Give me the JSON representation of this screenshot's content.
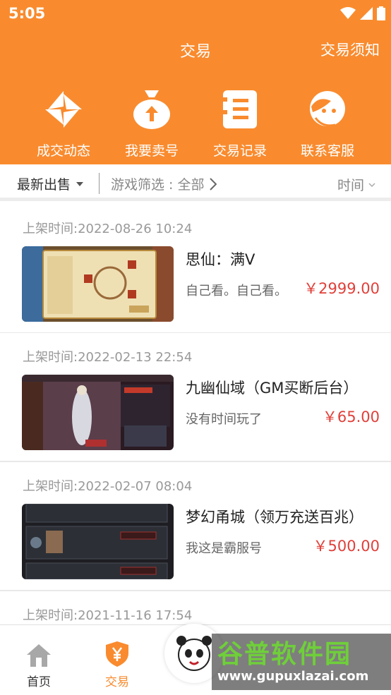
{
  "status_bar": {
    "time": "5:05"
  },
  "header": {
    "title": "交易",
    "notice": "交易须知"
  },
  "quick_menu": [
    {
      "label": "成交动态",
      "icon": "deals-icon"
    },
    {
      "label": "我要卖号",
      "icon": "money-bag-icon"
    },
    {
      "label": "交易记录",
      "icon": "record-icon"
    },
    {
      "label": "联系客服",
      "icon": "customer-service-icon"
    }
  ],
  "filter": {
    "sort": "最新出售",
    "game": "游戏筛选 : 全部",
    "time": "时间"
  },
  "listings": [
    {
      "date": "上架时间:2022-08-26 10:24",
      "title": "思仙：满V",
      "desc": "自己看。自己看。",
      "price": "￥2999.00"
    },
    {
      "date": "上架时间:2022-02-13 22:54",
      "title": "九幽仙域（GM买断后台）",
      "desc": "没有时间玩了",
      "price": "￥65.00"
    },
    {
      "date": "上架时间:2022-02-07 08:04",
      "title": "梦幻甬城（领万充送百兆）",
      "desc": "我这是霸服号",
      "price": "￥500.00"
    },
    {
      "date": "上架时间:2021-11-16 17:54",
      "title": "",
      "desc": "",
      "price": ""
    }
  ],
  "tabbar": {
    "home": "首页",
    "trade": "交易"
  },
  "watermark": {
    "title": "谷普软件园",
    "url": "www.gupuxlazai.com"
  },
  "colors": {
    "accent": "#f98b2e",
    "price": "#e0403a"
  }
}
